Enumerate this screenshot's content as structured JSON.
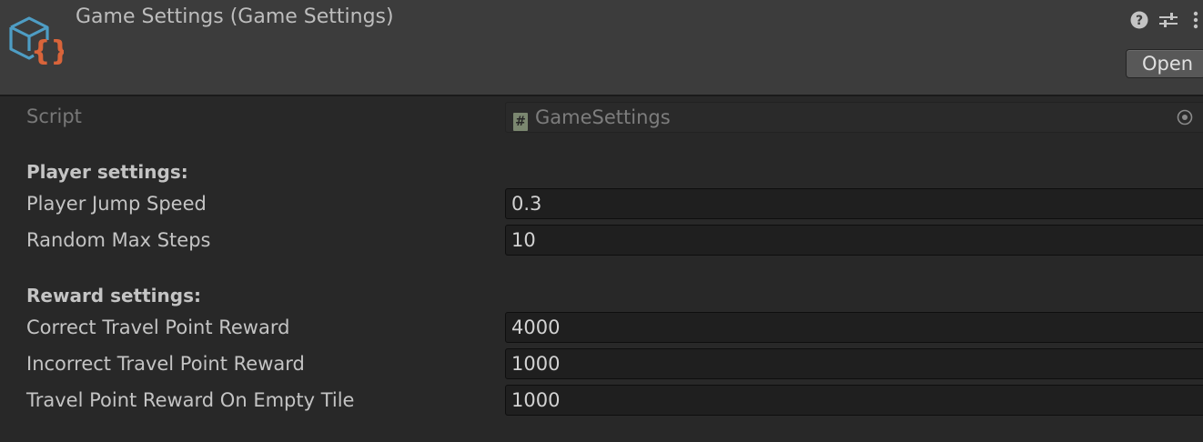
{
  "header": {
    "title": "Game Settings (Game Settings)",
    "asset_icon": "scriptable-object-icon",
    "icons": [
      "help-icon",
      "presets-icon",
      "more-menu-icon"
    ],
    "open_label": "Open"
  },
  "script_row": {
    "label": "Script",
    "value": "GameSettings",
    "icon": "script-icon"
  },
  "player_section": {
    "header": "Player settings:",
    "fields": [
      {
        "label": "Player Jump Speed",
        "value": "0.3"
      },
      {
        "label": "Random Max Steps",
        "value": "10"
      }
    ]
  },
  "reward_section": {
    "header": "Reward settings:",
    "fields": [
      {
        "label": "Correct Travel Point Reward",
        "value": "4000"
      },
      {
        "label": "Incorrect Travel Point Reward",
        "value": "1000"
      },
      {
        "label": "Travel Point Reward On Empty Tile",
        "value": "1000"
      }
    ]
  },
  "colors": {
    "background": "#282828",
    "header_background": "#3c3c3c",
    "field_background": "#1f1f1f",
    "icon_blue": "#4e9dc4",
    "icon_orange": "#d9643a"
  }
}
